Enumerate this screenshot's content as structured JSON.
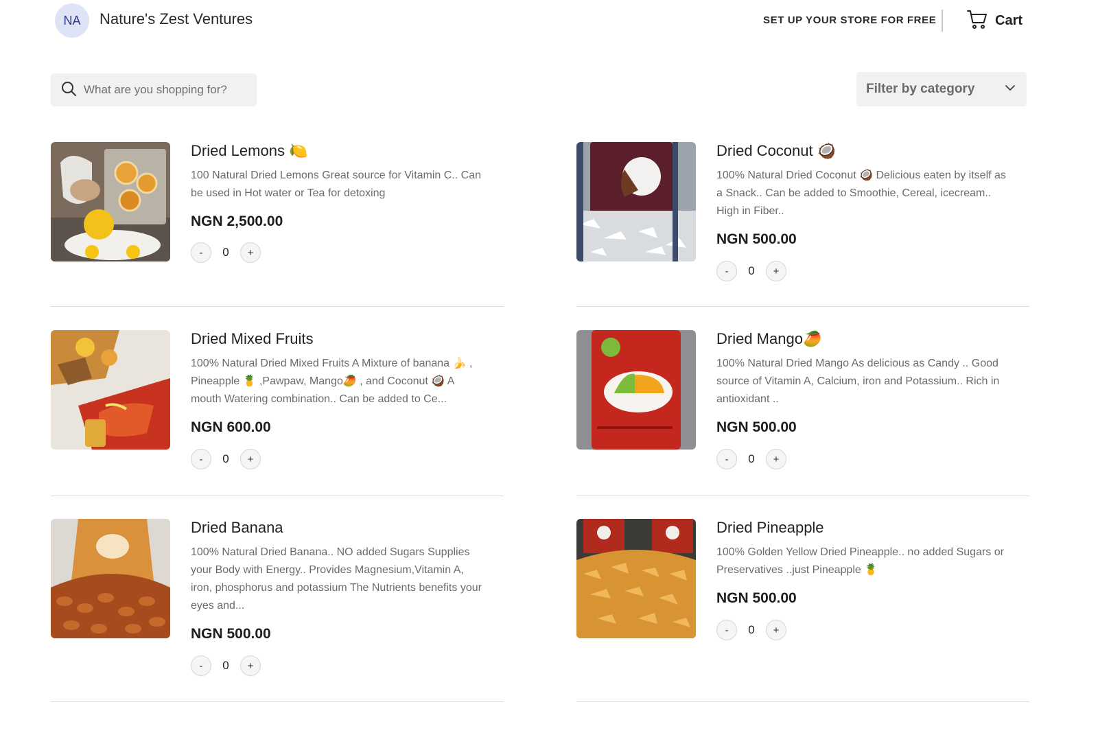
{
  "header": {
    "avatar_initials": "NA",
    "store_name": "Nature's Zest Ventures",
    "setup_link": "SET UP YOUR STORE FOR FREE",
    "cart_label": "Cart"
  },
  "search": {
    "placeholder": "What are you shopping for?"
  },
  "filter": {
    "label": "Filter by category"
  },
  "products": [
    {
      "name": "Dried Lemons 🍋",
      "description": "100 Natural Dried Lemons Great source for Vitamin C.. Can be used in Hot water or Tea for detoxing",
      "price": "NGN 2,500.00",
      "quantity": "0"
    },
    {
      "name": "Dried Coconut 🥥",
      "description": "100% Natural Dried Coconut 🥥 Delicious eaten by itself as a Snack.. Can be added to Smoothie, Cereal, icecream.. High in Fiber..",
      "price": "NGN 500.00",
      "quantity": "0"
    },
    {
      "name": "Dried Mixed Fruits",
      "description": "100% Natural Dried Mixed Fruits A Mixture of banana 🍌 , Pineapple 🍍 ,Pawpaw, Mango🥭 , and Coconut 🥥 A mouth Watering combination.. Can be added to Ce...",
      "price": "NGN 600.00",
      "quantity": "0"
    },
    {
      "name": "Dried Mango🥭",
      "description": "100% Natural Dried Mango As delicious as Candy .. Good source of Vitamin A, Calcium, iron and Potassium.. Rich in antioxidant ..",
      "price": "NGN 500.00",
      "quantity": "0"
    },
    {
      "name": "Dried Banana",
      "description": "100% Natural Dried Banana.. NO added Sugars Supplies your Body with Energy.. Provides Magnesium,Vitamin A, iron, phosphorus and potassium The Nutrients benefits your eyes and...",
      "price": "NGN 500.00",
      "quantity": "0"
    },
    {
      "name": "Dried Pineapple",
      "description": "100% Golden Yellow Dried Pineapple.. no added Sugars or Preservatives ..just Pineapple 🍍",
      "price": "NGN 500.00",
      "quantity": "0"
    }
  ],
  "qty_controls": {
    "minus": "-",
    "plus": "+"
  }
}
